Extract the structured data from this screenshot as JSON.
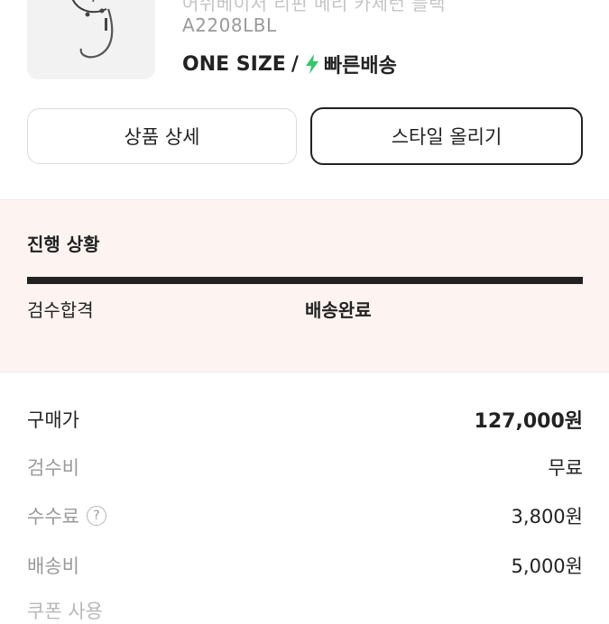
{
  "product": {
    "name_partial": "어쉬베이저 리핀 메리 카제턴 블랙",
    "model_code": "A2208LBL",
    "size": "ONE SIZE",
    "size_separator": "/",
    "shipping": "빠른배송",
    "shipping_icon": "lightning-bolt-icon",
    "shipping_icon_color": "#31c76a"
  },
  "buttons": {
    "detail": "상품 상세",
    "style": "스타일 올리기"
  },
  "progress": {
    "title": "진행 상황",
    "steps": [
      "검수합격",
      "배송완료"
    ],
    "fill_fraction": 1.0,
    "bar_color": "#222222",
    "background_color": "#fdf3f1"
  },
  "prices": {
    "purchase": {
      "label": "구매가",
      "value": "127,000원"
    },
    "inspection": {
      "label": "검수비",
      "value": "무료"
    },
    "fee": {
      "label": "수수료",
      "value": "3,800원",
      "help_icon": "question-circle-icon",
      "help_glyph": "?"
    },
    "delivery": {
      "label": "배송비",
      "value": "5,000원"
    },
    "coupon_partial": {
      "label": "쿠폰 사용"
    }
  }
}
